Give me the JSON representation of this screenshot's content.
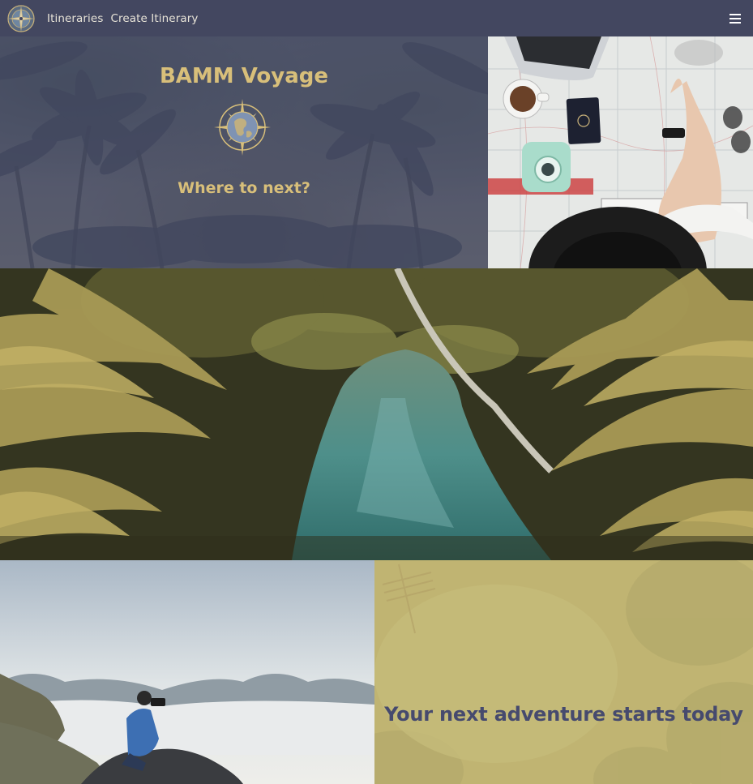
{
  "navbar": {
    "logo_icon": "compass-globe-icon",
    "links": [
      "Itineraries",
      "Create Itinerary"
    ],
    "menu_icon": "hamburger-menu-icon"
  },
  "hero": {
    "title": "BAMM Voyage",
    "emblem_icon": "compass-globe-icon",
    "subtitle": "Where to next?"
  },
  "gallery": {
    "map_photo": "travel-planning-photo",
    "river_photo": "jungle-river-photo",
    "mountain_photo": "photographer-mountain-photo"
  },
  "adventure": {
    "tagline": "Your next adventure starts today"
  },
  "colors": {
    "navbar_bg": "#434760",
    "gold_accent": "#d8bf7a",
    "indigo_text": "#464a6e"
  }
}
